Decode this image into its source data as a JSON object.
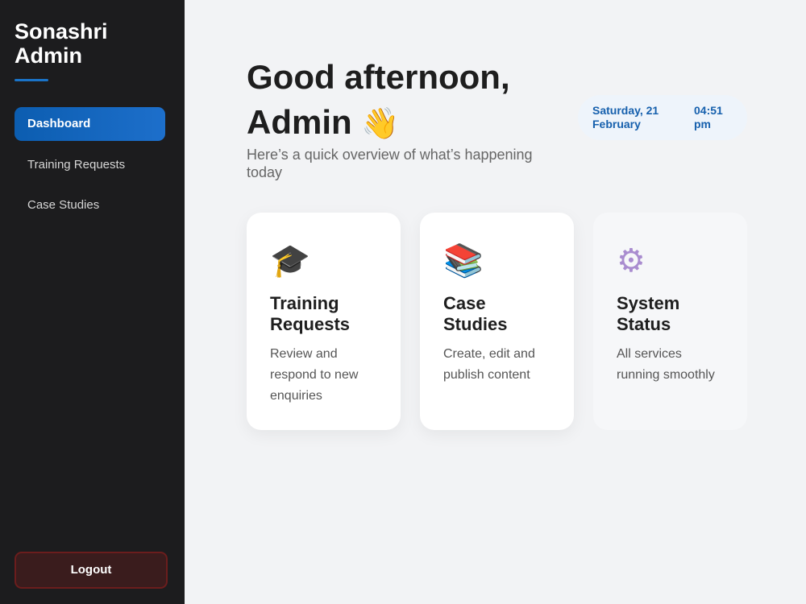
{
  "sidebar": {
    "brand": "Sonashri Admin",
    "items": [
      {
        "label": "Dashboard",
        "active": true
      },
      {
        "label": "Training Requests",
        "active": false
      },
      {
        "label": "Case Studies",
        "active": false
      }
    ],
    "logout_label": "Logout"
  },
  "header": {
    "greeting": "Good afternoon, Admin",
    "wave_emoji": "👋",
    "subtitle": "Here’s a quick overview of what’s happening today",
    "date": "Saturday, 21 February",
    "time": "04:51 pm"
  },
  "cards": [
    {
      "icon": "graduation-cap-icon",
      "glyph": "🎓",
      "title": "Training Requests",
      "description": "Review and respond to new enquiries"
    },
    {
      "icon": "books-icon",
      "glyph": "📚",
      "title": "Case Studies",
      "description": "Create, edit and publish content"
    },
    {
      "icon": "gear-icon",
      "glyph": "⚙",
      "title": "System Status",
      "description": "All services running smoothly"
    }
  ],
  "colors": {
    "sidebar_bg": "#1c1c1e",
    "accent": "#1660ad",
    "logout_border": "#6b1d1d"
  }
}
